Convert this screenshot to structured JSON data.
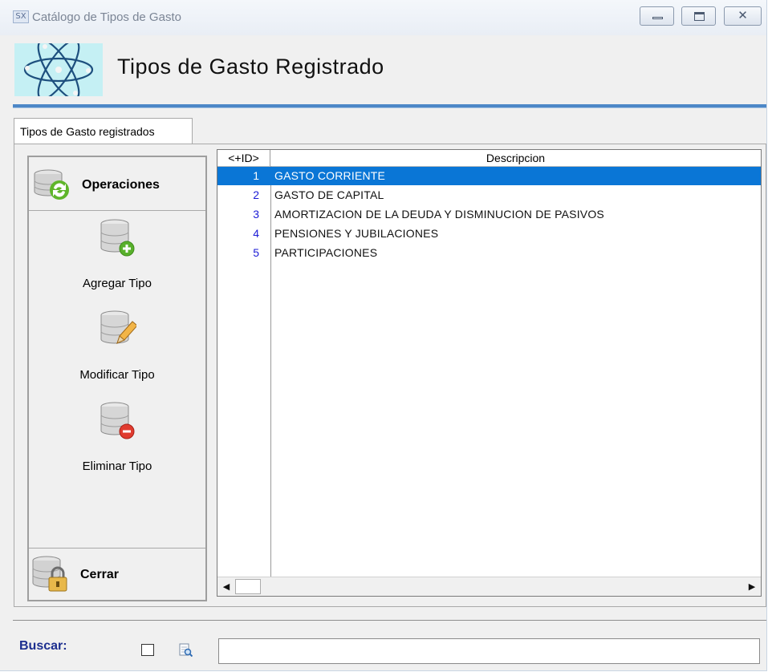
{
  "window": {
    "title": "Catálogo de Tipos de Gasto",
    "app_icon_text": "SX"
  },
  "header": {
    "title": "Tipos de Gasto Registrado"
  },
  "tab": {
    "label": "Tipos de Gasto registrados"
  },
  "operations": {
    "title": "Operaciones",
    "add_label": "Agregar Tipo",
    "edit_label": "Modificar Tipo",
    "delete_label": "Eliminar Tipo",
    "close_label": "Cerrar"
  },
  "grid": {
    "columns": [
      "<+ID>",
      "Descripcion"
    ],
    "rows": [
      {
        "id": "1",
        "desc": "GASTO CORRIENTE",
        "selected": true
      },
      {
        "id": "2",
        "desc": "GASTO DE CAPITAL",
        "selected": false
      },
      {
        "id": "3",
        "desc": "AMORTIZACION DE LA DEUDA Y DISMINUCION DE PASIVOS",
        "selected": false
      },
      {
        "id": "4",
        "desc": "PENSIONES Y JUBILACIONES",
        "selected": false
      },
      {
        "id": "5",
        "desc": "PARTICIPACIONES",
        "selected": false
      }
    ]
  },
  "search": {
    "label": "Buscar:",
    "value": ""
  },
  "colors": {
    "selection": "#0a76d6",
    "id_text": "#1b1bd6",
    "search_label": "#1c2e8f",
    "header_rule": "#4c87c7"
  }
}
